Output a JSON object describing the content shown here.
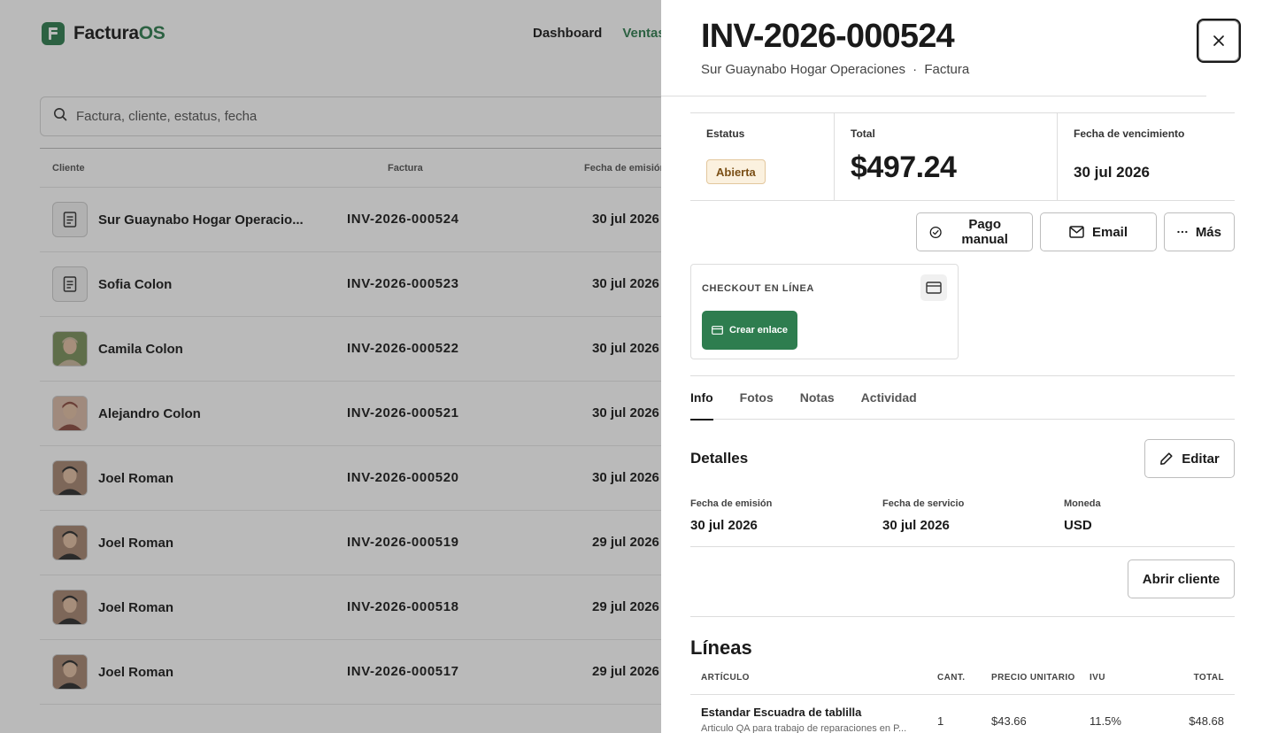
{
  "app": {
    "brand_main": "Factura",
    "brand_accent": "OS",
    "nav": [
      "Dashboard",
      "Ventas"
    ]
  },
  "search": {
    "placeholder": "Factura, cliente, estatus, fecha"
  },
  "table": {
    "headers": {
      "client": "Cliente",
      "invoice": "Factura",
      "issue_date": "Fecha de emisión"
    },
    "rows": [
      {
        "client": "Sur Guaynabo Hogar Operacio...",
        "invoice": "INV-2026-000524",
        "date": "30 jul 2026",
        "avatar": "document-icon"
      },
      {
        "client": "Sofia Colon",
        "invoice": "INV-2026-000523",
        "date": "30 jul 2026",
        "avatar": "document-icon"
      },
      {
        "client": "Camila Colon",
        "invoice": "INV-2026-000522",
        "date": "30 jul 2026",
        "avatar": "photo"
      },
      {
        "client": "Alejandro Colon",
        "invoice": "INV-2026-000521",
        "date": "30 jul 2026",
        "avatar": "photo"
      },
      {
        "client": "Joel Roman",
        "invoice": "INV-2026-000520",
        "date": "30 jul 2026",
        "avatar": "photo"
      },
      {
        "client": "Joel Roman",
        "invoice": "INV-2026-000519",
        "date": "29 jul 2026",
        "avatar": "photo"
      },
      {
        "client": "Joel Roman",
        "invoice": "INV-2026-000518",
        "date": "29 jul 2026",
        "avatar": "photo"
      },
      {
        "client": "Joel Roman",
        "invoice": "INV-2026-000517",
        "date": "29 jul 2026",
        "avatar": "photo"
      }
    ]
  },
  "drawer": {
    "title": "INV-2026-000524",
    "subtitle_client": "Sur Guaynabo Hogar Operaciones",
    "subtitle_sep": "·",
    "subtitle_type": "Factura",
    "status_label": "Estatus",
    "status_value": "Abierta",
    "total_label": "Total",
    "total_value": "$497.24",
    "due_label": "Fecha de vencimiento",
    "due_value": "30 jul 2026",
    "actions": {
      "manual_payment": "Pago manual",
      "email": "Email",
      "more": "Más"
    },
    "checkout": {
      "label": "CHECKOUT EN LÍNEA",
      "create_link": "Crear enlace"
    },
    "tabs": [
      "Info",
      "Fotos",
      "Notas",
      "Actividad"
    ],
    "details": {
      "title": "Detalles",
      "edit": "Editar",
      "issue_label": "Fecha de emisión",
      "issue_value": "30 jul 2026",
      "service_label": "Fecha de servicio",
      "service_value": "30 jul 2026",
      "currency_label": "Moneda",
      "currency_value": "USD",
      "open_client": "Abrir cliente"
    },
    "lines": {
      "title": "Líneas",
      "headers": {
        "item": "ARTÍCULO",
        "qty": "CANT.",
        "unit_price": "PRECIO UNITARIO",
        "tax": "IVU",
        "total": "TOTAL"
      },
      "rows": [
        {
          "name": "Estandar Escuadra de tablilla",
          "desc": "Articulo QA para trabajo de reparaciones en P...",
          "qty": "1",
          "unit_price": "$43.66",
          "tax": "11.5%",
          "total": "$48.68"
        }
      ]
    }
  },
  "colors": {
    "brand": "#2e7d4f",
    "badge_bg": "#fbf1df",
    "badge_text": "#7a4f16"
  }
}
